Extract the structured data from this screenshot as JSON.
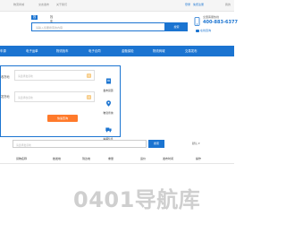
{
  "topbar": {
    "links": [
      "物流商城",
      "交友发布",
      "关于我们"
    ],
    "right_links": [
      "登录",
      "免费注册"
    ],
    "extra": "我的"
  },
  "search": {
    "tabs": [
      "找货",
      "找车"
    ],
    "placeholder": "请输入您要搜索的内容",
    "button_label": "搜索"
  },
  "hotline": {
    "label": "全国客服热线",
    "number": "400-883-6377",
    "consult_label": "在线咨询"
  },
  "nav": {
    "items": [
      "车源",
      "电子运单",
      "物流找车",
      "电子合同",
      "金融保险",
      "物流商城",
      "交易发布"
    ]
  },
  "query_panel": {
    "origin_label": "发货地",
    "origin_placeholder": "请选择发货地",
    "destination_label": "收货地",
    "destination_placeholder": "请选择收货地",
    "query_button": "快速查询",
    "side_items": [
      {
        "label": "发布货源",
        "icon": "document-icon"
      },
      {
        "label": "物流查询",
        "icon": "location-pin-icon"
      },
      {
        "label": "车辆信息",
        "icon": "truck-icon"
      }
    ]
  },
  "filter": {
    "placeholder": "请选择发货地",
    "button_label": "搜索",
    "sort_label": "默认 ▾"
  },
  "table": {
    "headers": [
      "货物名称",
      "始发地",
      "到达地",
      "重量",
      "运价",
      "发布时间",
      "操作"
    ]
  },
  "watermark": {
    "text": "0401导航库"
  },
  "colors": {
    "brand_blue": "#1b74d1",
    "accent_orange": "#ff7a2b"
  }
}
